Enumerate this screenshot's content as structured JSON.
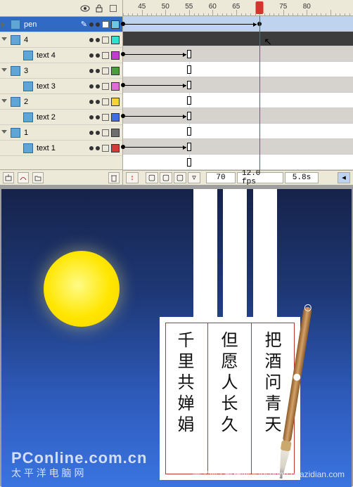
{
  "layers": {
    "items": [
      {
        "name": "pen",
        "color": "#6cc7e6",
        "selected": true,
        "indent": false,
        "expanded": false
      },
      {
        "name": "4",
        "color": "#2fe2d0",
        "selected": false,
        "indent": false,
        "expanded": true
      },
      {
        "name": "text 4",
        "color": "#c13fd0",
        "selected": false,
        "indent": true,
        "expanded": false
      },
      {
        "name": "3",
        "color": "#4a9e3e",
        "selected": false,
        "indent": false,
        "expanded": true
      },
      {
        "name": "text 3",
        "color": "#e06cd8",
        "selected": false,
        "indent": true,
        "expanded": false
      },
      {
        "name": "2",
        "color": "#f2d33a",
        "selected": false,
        "indent": false,
        "expanded": true
      },
      {
        "name": "text 2",
        "color": "#3b6fe2",
        "selected": false,
        "indent": true,
        "expanded": false
      },
      {
        "name": "1",
        "color": "#6e6e6e",
        "selected": false,
        "indent": false,
        "expanded": true
      },
      {
        "name": "text 1",
        "color": "#d53a3a",
        "selected": false,
        "indent": true,
        "expanded": false
      }
    ]
  },
  "timeline": {
    "ruler": [
      "45",
      "50",
      "55",
      "60",
      "65",
      "70",
      "75",
      "80"
    ],
    "playhead_frame": 70,
    "footer": {
      "frame": "70",
      "fps": "12.0 fps",
      "time": "5.8s"
    }
  },
  "poem": {
    "col1": "把酒问青天",
    "col2": "但愿人长久",
    "col3": "千里共婵娟"
  },
  "watermarks": {
    "main": "PConline.com.cn",
    "sub": "太 平 洋 电 脑 网",
    "right": "慢宝典 | 教程网  jiaocheng.chazidian.com"
  }
}
